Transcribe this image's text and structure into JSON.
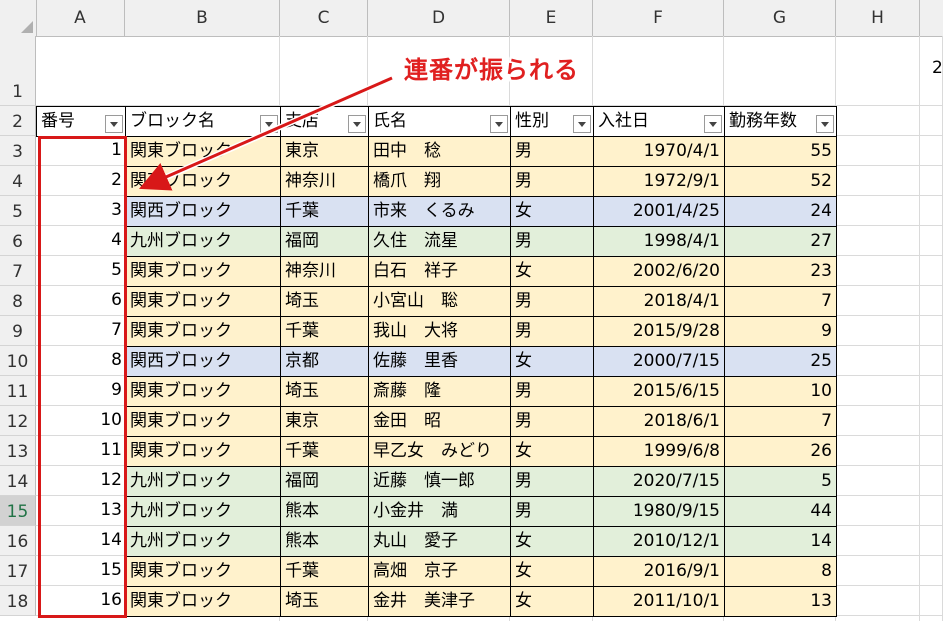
{
  "columns": [
    "A",
    "B",
    "C",
    "D",
    "E",
    "F",
    "G",
    "H"
  ],
  "row_numbers": [
    "1",
    "2",
    "3",
    "4",
    "5",
    "6",
    "7",
    "8",
    "9",
    "10",
    "11",
    "12",
    "13",
    "14",
    "15",
    "16",
    "17",
    "18"
  ],
  "selected_row": "15",
  "callout": "連番が振られる",
  "offscreen_text": "2",
  "headers": [
    "番号",
    "ブロック名",
    "支店",
    "氏名",
    "性別",
    "入社日",
    "勤務年数"
  ],
  "rows": [
    {
      "no": "1",
      "block": "関東ブロック",
      "branch": "東京",
      "name": "田中　稔",
      "sex": "男",
      "date": "1970/4/1",
      "years": "55",
      "region": "kanto"
    },
    {
      "no": "2",
      "block": "関東ブロック",
      "branch": "神奈川",
      "name": "橋爪　翔",
      "sex": "男",
      "date": "1972/9/1",
      "years": "52",
      "region": "kanto"
    },
    {
      "no": "3",
      "block": "関西ブロック",
      "branch": "千葉",
      "name": "市来　くるみ",
      "sex": "女",
      "date": "2001/4/25",
      "years": "24",
      "region": "kansai"
    },
    {
      "no": "4",
      "block": "九州ブロック",
      "branch": "福岡",
      "name": "久住　流星",
      "sex": "男",
      "date": "1998/4/1",
      "years": "27",
      "region": "kyushu"
    },
    {
      "no": "5",
      "block": "関東ブロック",
      "branch": "神奈川",
      "name": "白石　祥子",
      "sex": "女",
      "date": "2002/6/20",
      "years": "23",
      "region": "kanto"
    },
    {
      "no": "6",
      "block": "関東ブロック",
      "branch": "埼玉",
      "name": "小宮山　聡",
      "sex": "男",
      "date": "2018/4/1",
      "years": "7",
      "region": "kanto"
    },
    {
      "no": "7",
      "block": "関東ブロック",
      "branch": "千葉",
      "name": "我山　大将",
      "sex": "男",
      "date": "2015/9/28",
      "years": "9",
      "region": "kanto"
    },
    {
      "no": "8",
      "block": "関西ブロック",
      "branch": "京都",
      "name": "佐藤　里香",
      "sex": "女",
      "date": "2000/7/15",
      "years": "25",
      "region": "kansai"
    },
    {
      "no": "9",
      "block": "関東ブロック",
      "branch": "埼玉",
      "name": "斎藤　隆",
      "sex": "男",
      "date": "2015/6/15",
      "years": "10",
      "region": "kanto"
    },
    {
      "no": "10",
      "block": "関東ブロック",
      "branch": "東京",
      "name": "金田　昭",
      "sex": "男",
      "date": "2018/6/1",
      "years": "7",
      "region": "kanto"
    },
    {
      "no": "11",
      "block": "関東ブロック",
      "branch": "千葉",
      "name": "早乙女　みどり",
      "sex": "女",
      "date": "1999/6/8",
      "years": "26",
      "region": "kanto"
    },
    {
      "no": "12",
      "block": "九州ブロック",
      "branch": "福岡",
      "name": "近藤　慎一郎",
      "sex": "男",
      "date": "2020/7/15",
      "years": "5",
      "region": "kyushu"
    },
    {
      "no": "13",
      "block": "九州ブロック",
      "branch": "熊本",
      "name": "小金井　満",
      "sex": "男",
      "date": "1980/9/15",
      "years": "44",
      "region": "kyushu"
    },
    {
      "no": "14",
      "block": "九州ブロック",
      "branch": "熊本",
      "name": "丸山　愛子",
      "sex": "女",
      "date": "2010/12/1",
      "years": "14",
      "region": "kyushu"
    },
    {
      "no": "15",
      "block": "関東ブロック",
      "branch": "千葉",
      "name": "高畑　京子",
      "sex": "女",
      "date": "2016/9/1",
      "years": "8",
      "region": "kanto"
    },
    {
      "no": "16",
      "block": "関東ブロック",
      "branch": "埼玉",
      "name": "金井　美津子",
      "sex": "女",
      "date": "2011/10/1",
      "years": "13",
      "region": "kanto"
    }
  ],
  "colors": {
    "kanto": "#fff2cc",
    "kansai": "#d9e1f2",
    "kyushu": "#e2efda",
    "accent": "#d81818"
  }
}
